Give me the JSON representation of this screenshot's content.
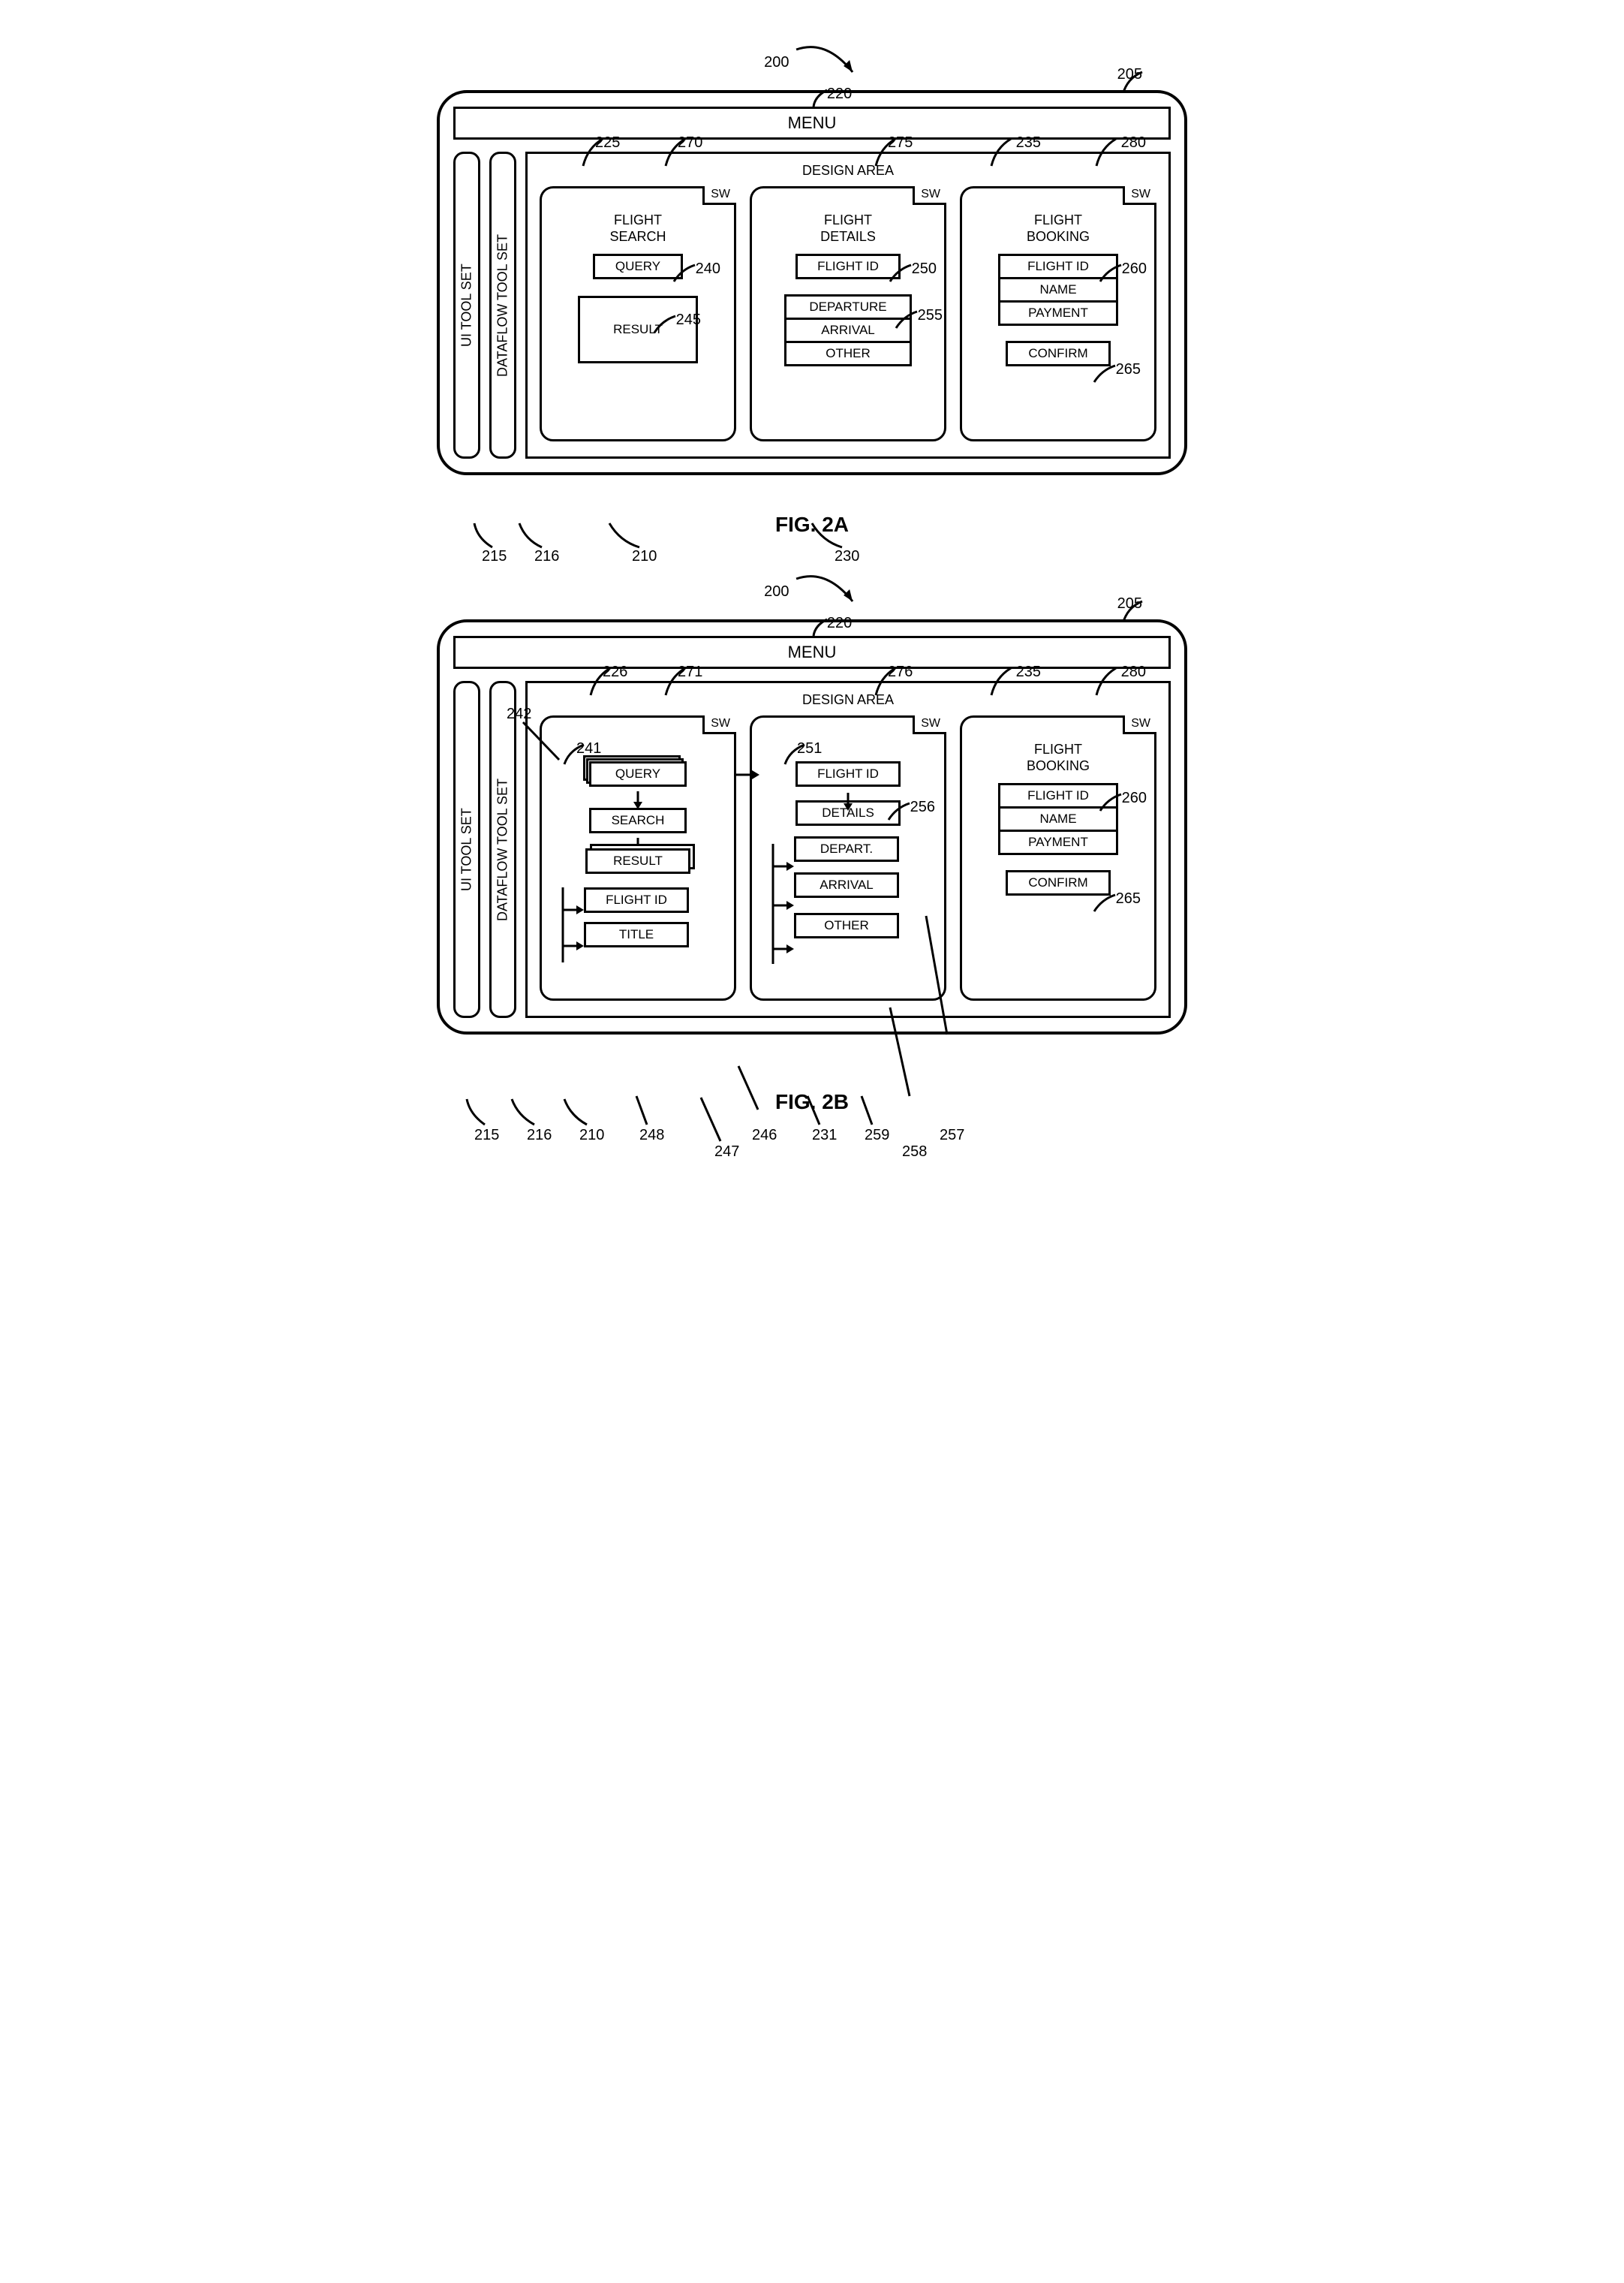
{
  "top_ref": "200",
  "figA": {
    "caption": "FIG. 2A",
    "menu": "MENU",
    "ui_tab": "UI TOOL SET",
    "dataflow_tab": "DATAFLOW TOOL SET",
    "design_area": "DESIGN AREA",
    "sw": "SW",
    "panels": [
      {
        "title": "FLIGHT\nSEARCH",
        "boxes": {
          "query": "QUERY",
          "result": "RESULT"
        }
      },
      {
        "title": "FLIGHT\nDETAILS",
        "boxes": {
          "flight_id": "FLIGHT ID",
          "departure": "DEPARTURE",
          "arrival": "ARRIVAL",
          "other": "OTHER"
        }
      },
      {
        "title": "FLIGHT\nBOOKING",
        "boxes": {
          "flight_id": "FLIGHT ID",
          "name": "NAME",
          "payment": "PAYMENT",
          "confirm": "CONFIRM"
        }
      }
    ],
    "refs": {
      "r205": "205",
      "r220": "220",
      "r225": "225",
      "r270": "270",
      "r275": "275",
      "r235": "235",
      "r280": "280",
      "r240": "240",
      "r245": "245",
      "r250": "250",
      "r255": "255",
      "r260": "260",
      "r265": "265",
      "r215": "215",
      "r216": "216",
      "r210": "210",
      "r230": "230"
    }
  },
  "figB": {
    "caption": "FIG. 2B",
    "menu": "MENU",
    "ui_tab": "UI TOOL SET",
    "dataflow_tab": "DATAFLOW TOOL SET",
    "design_area": "DESIGN AREA",
    "sw": "SW",
    "panels": [
      {
        "boxes": {
          "query": "QUERY",
          "search": "SEARCH",
          "result": "RESULT",
          "flight_id": "FLIGHT ID",
          "title": "TITLE"
        }
      },
      {
        "boxes": {
          "flight_id": "FLIGHT ID",
          "details": "DETAILS",
          "depart": "DEPART.",
          "arrival": "ARRIVAL",
          "other": "OTHER"
        }
      },
      {
        "title": "FLIGHT\nBOOKING",
        "boxes": {
          "flight_id": "FLIGHT ID",
          "name": "NAME",
          "payment": "PAYMENT",
          "confirm": "CONFIRM"
        }
      }
    ],
    "refs": {
      "r205": "205",
      "r220": "220",
      "r226": "226",
      "r271": "271",
      "r276": "276",
      "r235": "235",
      "r280": "280",
      "r241": "241",
      "r242": "242",
      "r251": "251",
      "r256": "256",
      "r260": "260",
      "r265": "265",
      "r215": "215",
      "r216": "216",
      "r210": "210",
      "r248": "248",
      "r246": "246",
      "r247": "247",
      "r231": "231",
      "r259": "259",
      "r257": "257",
      "r258": "258"
    }
  }
}
